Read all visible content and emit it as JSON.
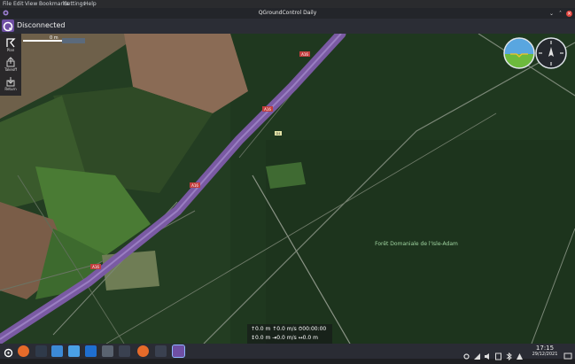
{
  "menubar": {
    "items": [
      "File",
      "Edit",
      "View",
      "Bookmarks",
      "Settings",
      "Help"
    ]
  },
  "window": {
    "title": "QGroundControl Daily"
  },
  "toolbar": {
    "connection_status": "Disconnected"
  },
  "left_toolbar": {
    "tools": [
      {
        "label": "Plan",
        "icon": "plan-icon"
      },
      {
        "label": "Takeoff",
        "icon": "takeoff-icon"
      },
      {
        "label": "Return",
        "icon": "return-icon"
      }
    ]
  },
  "map": {
    "scale_label": "0 m",
    "place_label": "Forêt Domaniale de l'Isle-Adam",
    "road_labels": {
      "highway_a": "A16",
      "highway_b": "A16",
      "highway_c": "A16",
      "highway_d": "A16",
      "road_d1": "D4"
    }
  },
  "telemetry": {
    "row1": "↑0.0 m  ↑0.0 m/s  ⏱00:00:00",
    "row2": "↕0.0 m  ⇥0.0 m/s  ↔0.0 m"
  },
  "taskbar": {
    "clock_time": "17:15",
    "clock_date": "29/12/2021"
  },
  "colors": {
    "forest": "#233d22",
    "field": "#6b5e46",
    "highway": "#7a5aa3",
    "accent": "#6f4fa4"
  }
}
